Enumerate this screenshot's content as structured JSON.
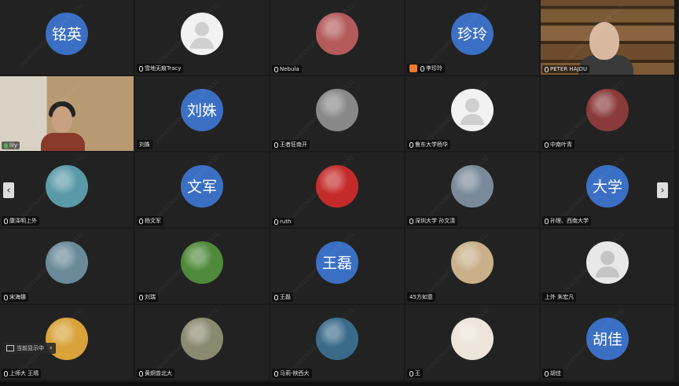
{
  "tiles": [
    {
      "type": "text",
      "avatar": "铭英",
      "label": "",
      "mic": false
    },
    {
      "type": "blank",
      "avatar": "",
      "label": "雪地无痕Tracy",
      "mic": true
    },
    {
      "type": "photo",
      "avatar": "",
      "label": "Nebula",
      "mic": true,
      "color": "#b45a5a"
    },
    {
      "type": "text",
      "avatar": "珍玲",
      "label": "李珍玲",
      "mic": true,
      "hand": true
    },
    {
      "type": "video",
      "avatar": "",
      "label": "PETER HAJDU",
      "mic": true
    },
    {
      "type": "video2",
      "avatar": "",
      "label": "lily",
      "mic": true,
      "active": true
    },
    {
      "type": "text",
      "avatar": "刘姝",
      "label": "刘姝",
      "mic": false
    },
    {
      "type": "photo",
      "avatar": "",
      "label": "王者狂南开",
      "mic": true,
      "color": "#888888"
    },
    {
      "type": "blank",
      "avatar": "",
      "label": "鲁东大学杨华",
      "mic": true
    },
    {
      "type": "photo",
      "avatar": "",
      "label": "中南叶青",
      "mic": true,
      "color": "#8a3a3a"
    },
    {
      "type": "photo",
      "avatar": "",
      "label": "康泽明上外",
      "mic": true,
      "color": "#5a9aa8"
    },
    {
      "type": "text",
      "avatar": "文军",
      "label": "杨文军",
      "mic": true
    },
    {
      "type": "photo",
      "avatar": "",
      "label": "ruth",
      "mic": true,
      "color": "#c42a2a"
    },
    {
      "type": "photo",
      "avatar": "",
      "label": "深圳大学 孙文清",
      "mic": true,
      "color": "#7a8a9a"
    },
    {
      "type": "text",
      "avatar": "大学",
      "label": "孙理、西南大学",
      "mic": true
    },
    {
      "type": "photo",
      "avatar": "",
      "label": "宋海娜",
      "mic": true,
      "color": "#6a8a9a"
    },
    {
      "type": "photo",
      "avatar": "",
      "label": "刘瑞",
      "mic": true,
      "color": "#4f8a3a"
    },
    {
      "type": "text",
      "avatar": "王磊",
      "label": "王磊",
      "mic": true
    },
    {
      "type": "photo",
      "avatar": "",
      "label": "45方如意",
      "mic": false,
      "color": "#c9b08a"
    },
    {
      "type": "white",
      "avatar": "",
      "label": "上外 朱宏凡",
      "mic": false
    },
    {
      "type": "photo",
      "avatar": "",
      "label": "上师大 王晴",
      "mic": true,
      "color": "#d9a23a"
    },
    {
      "type": "photo",
      "avatar": "",
      "label": "黄炯曾北大",
      "mic": true,
      "color": "#8a8a70"
    },
    {
      "type": "photo",
      "avatar": "",
      "label": "马莉-陕西大",
      "mic": true,
      "color": "#3a6a8a"
    },
    {
      "type": "photo",
      "avatar": "",
      "label": "王",
      "mic": true,
      "color": "#ede4da"
    },
    {
      "type": "text",
      "avatar": "胡佳",
      "label": "胡佳",
      "mic": true
    }
  ],
  "nav": {
    "prev": "‹",
    "next": "›"
  },
  "share": {
    "label": "当前显示中",
    "chevron": "‹"
  },
  "watermark": "jinjin0190000650 清华大学 5531"
}
